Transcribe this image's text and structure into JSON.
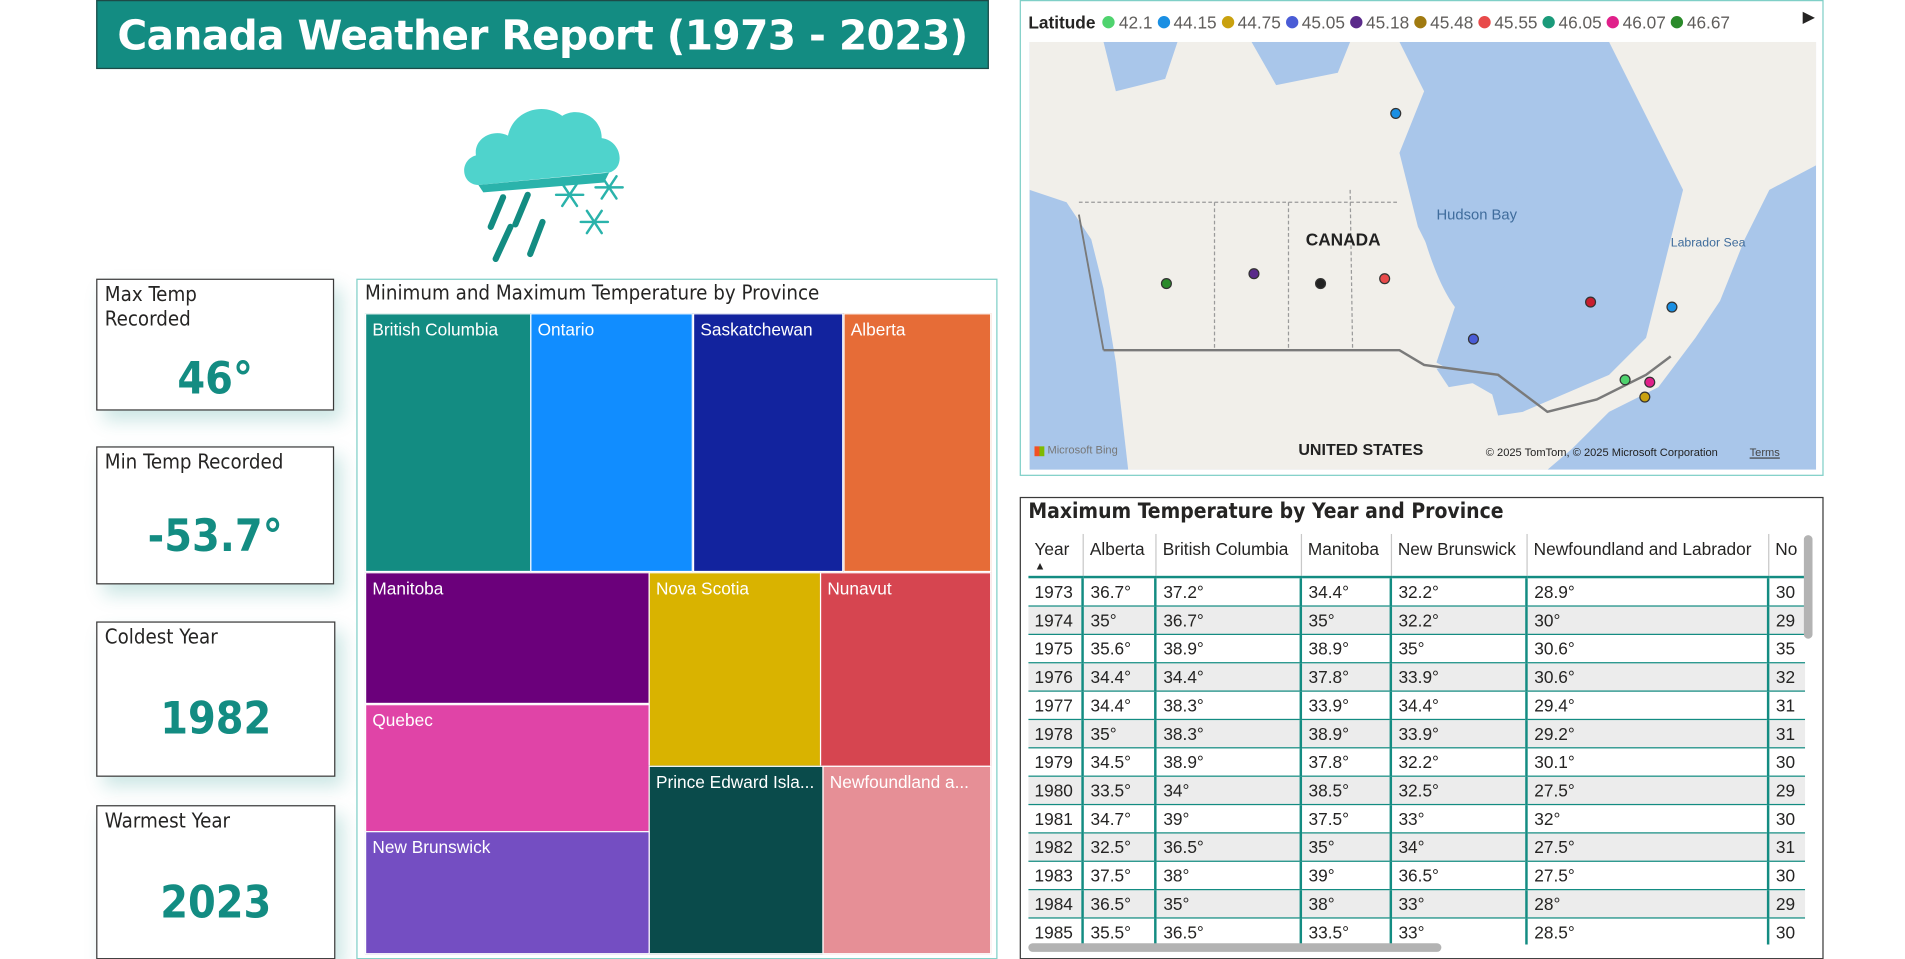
{
  "title": "Canada Weather Report (1973 - 2023)",
  "colors": {
    "accent": "#138c82",
    "icon_cloud": "#4fd3cc"
  },
  "kpis": {
    "max_temp": {
      "label": "Max Temp\nRecorded",
      "value": "46°"
    },
    "min_temp": {
      "label": "Min Temp Recorded",
      "value": "-53.7°"
    },
    "coldest_year": {
      "label": "Coldest Year",
      "value": "1982"
    },
    "warmest_year": {
      "label": "Warmest Year",
      "value": "2023"
    }
  },
  "treemap": {
    "title": "Minimum and Maximum Temperature by Province",
    "tiles": [
      {
        "label": "British Columbia",
        "color": "#138c82"
      },
      {
        "label": "Ontario",
        "color": "#118dff"
      },
      {
        "label": "Saskatchewan",
        "color": "#12239e"
      },
      {
        "label": "Alberta",
        "color": "#e66c37"
      },
      {
        "label": "Manitoba",
        "color": "#6b007b"
      },
      {
        "label": "Nova Scotia",
        "color": "#d9b300"
      },
      {
        "label": "Nunavut",
        "color": "#d64550"
      },
      {
        "label": "Quebec",
        "color": "#e044a7"
      },
      {
        "label": "Prince Edward Isla...",
        "color": "#0a4b4b"
      },
      {
        "label": "Newfoundland a...",
        "color": "#e68f96"
      },
      {
        "label": "New Brunswick",
        "color": "#744ec2"
      }
    ]
  },
  "map": {
    "legend_title": "Latitude",
    "legend": [
      {
        "label": "42.1",
        "color": "#4fd36e"
      },
      {
        "label": "44.15",
        "color": "#1a8fe3"
      },
      {
        "label": "44.75",
        "color": "#c9a10e"
      },
      {
        "label": "45.05",
        "color": "#4a5cd6"
      },
      {
        "label": "45.18",
        "color": "#5a2a8a"
      },
      {
        "label": "45.48",
        "color": "#a07a10"
      },
      {
        "label": "45.55",
        "color": "#e84a4a"
      },
      {
        "label": "46.05",
        "color": "#1a9a7a"
      },
      {
        "label": "46.07",
        "color": "#e0208a"
      },
      {
        "label": "46.67",
        "color": "#2a8a2a"
      }
    ],
    "labels": {
      "canada": "CANADA",
      "hudson_bay": "Hudson Bay",
      "labrador_sea": "Labrador Sea",
      "united_states": "UNITED STATES",
      "attribution": "© 2025 TomTom, © 2025 Microsoft Corporation",
      "terms": "Terms",
      "bing": "Microsoft Bing"
    },
    "next_icon": "triangle-right-icon"
  },
  "table": {
    "title": "Maximum Temperature by Year and Province",
    "columns": [
      "Year",
      "Alberta",
      "British Columbia",
      "Manitoba",
      "New Brunswick",
      "Newfoundland and Labrador",
      "No"
    ],
    "rows": [
      [
        "1973",
        "36.7°",
        "37.2°",
        "34.4°",
        "32.2°",
        "28.9°",
        "30"
      ],
      [
        "1974",
        "35°",
        "36.7°",
        "35°",
        "32.2°",
        "30°",
        "29"
      ],
      [
        "1975",
        "35.6°",
        "38.9°",
        "38.9°",
        "35°",
        "30.6°",
        "35"
      ],
      [
        "1976",
        "34.4°",
        "34.4°",
        "37.8°",
        "33.9°",
        "30.6°",
        "32"
      ],
      [
        "1977",
        "34.4°",
        "38.3°",
        "33.9°",
        "34.4°",
        "29.4°",
        "31"
      ],
      [
        "1978",
        "35°",
        "38.3°",
        "38.9°",
        "33.9°",
        "29.2°",
        "31"
      ],
      [
        "1979",
        "34.5°",
        "38.9°",
        "37.8°",
        "32.2°",
        "30.1°",
        "30"
      ],
      [
        "1980",
        "33.5°",
        "34°",
        "38.5°",
        "32.5°",
        "27.5°",
        "29"
      ],
      [
        "1981",
        "34.7°",
        "39°",
        "37.5°",
        "33°",
        "32°",
        "30"
      ],
      [
        "1982",
        "32.5°",
        "36.5°",
        "35°",
        "34°",
        "27.5°",
        "31"
      ],
      [
        "1983",
        "37.5°",
        "38°",
        "39°",
        "36.5°",
        "27.5°",
        "30"
      ],
      [
        "1984",
        "36.5°",
        "35°",
        "38°",
        "33°",
        "28°",
        "29"
      ],
      [
        "1985",
        "35.5°",
        "36.5°",
        "33.5°",
        "33°",
        "28.5°",
        "30"
      ]
    ]
  }
}
